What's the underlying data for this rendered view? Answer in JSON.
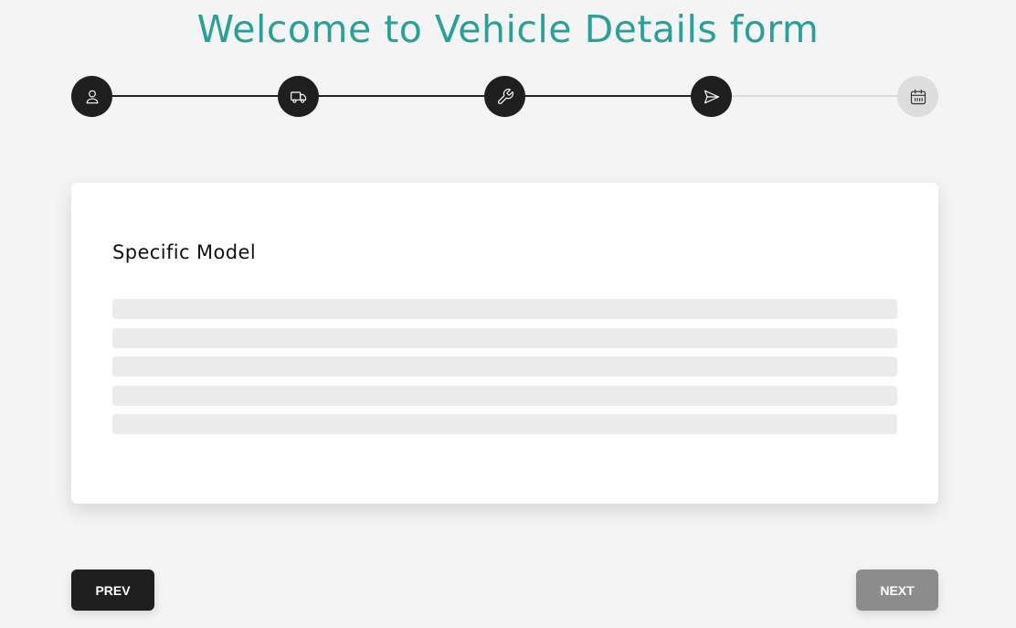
{
  "page": {
    "title": "Welcome to Vehicle Details form"
  },
  "stepper": {
    "steps": [
      {
        "icon": "user-icon",
        "state": "complete"
      },
      {
        "icon": "truck-icon",
        "state": "complete"
      },
      {
        "icon": "wrench-icon",
        "state": "complete"
      },
      {
        "icon": "send-icon",
        "state": "current"
      },
      {
        "icon": "calendar-icon",
        "state": "pending"
      }
    ],
    "completed_connectors": 3
  },
  "card": {
    "title": "Specific Model",
    "loading_rows": 5
  },
  "buttons": {
    "prev_label": "PREV",
    "next_label": "NEXT",
    "next_disabled": true
  },
  "colors": {
    "title": "#2aa198",
    "step_active_bg": "#1f1f1f",
    "step_active_icon": "#ffffff",
    "step_pending_bg": "#dddddd",
    "step_pending_icon": "#333333",
    "line_active": "#222222",
    "line_pending": "#dcdcdc",
    "skeleton": "#ebebeb",
    "prev_button": "#1f1f1f",
    "next_button_disabled": "#8c8c8c"
  }
}
